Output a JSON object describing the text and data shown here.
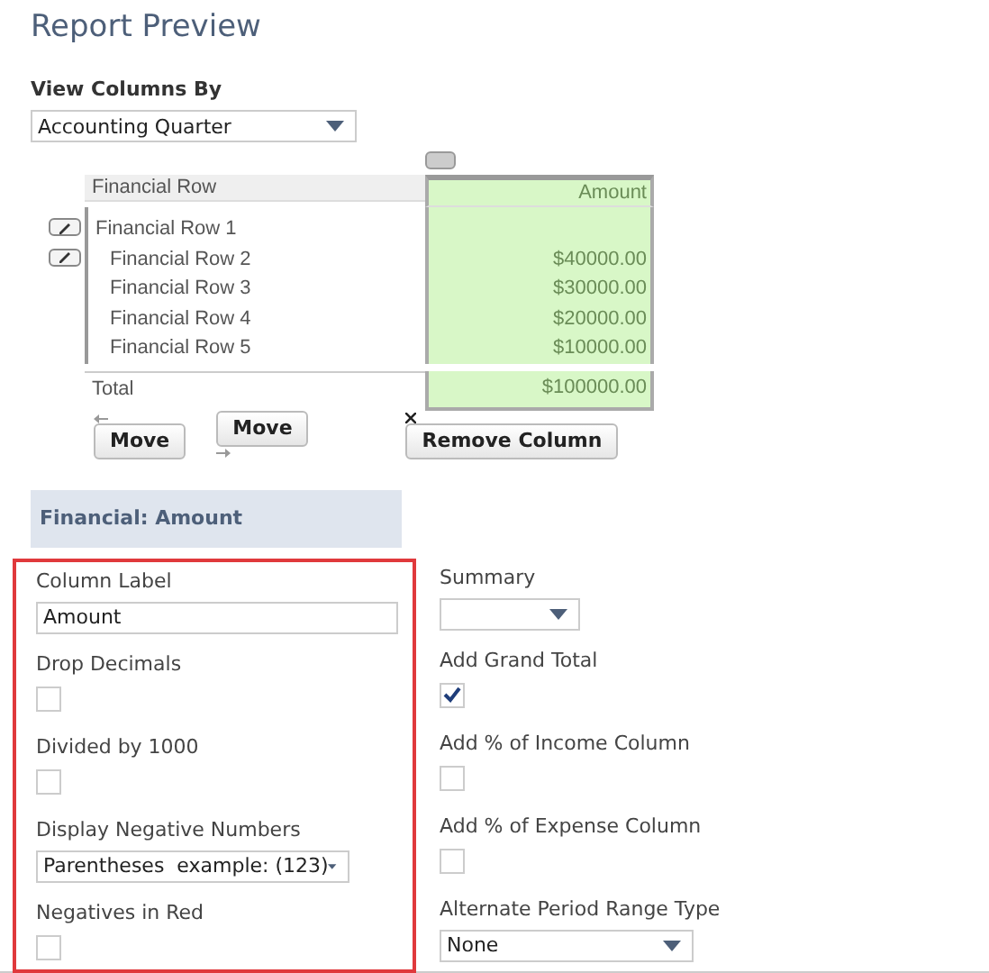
{
  "title": "Report Preview",
  "view_columns_by": {
    "label": "View Columns By",
    "value": "Accounting Quarter"
  },
  "table": {
    "columns": [
      "Financial Row",
      "Amount"
    ],
    "rows": [
      {
        "label": "Financial Row 1",
        "amount": "",
        "editable": true,
        "children": [
          {
            "label": "Financial Row 2",
            "amount": "$40000.00",
            "editable": true
          },
          {
            "label": "Financial Row 3",
            "amount": "$30000.00",
            "editable": false
          },
          {
            "label": "Financial Row 4",
            "amount": "$20000.00",
            "editable": false
          },
          {
            "label": "Financial Row 5",
            "amount": "$10000.00",
            "editable": false
          }
        ]
      }
    ],
    "total": {
      "label": "Total",
      "amount": "$100000.00"
    }
  },
  "buttons": [
    {
      "label": "Move",
      "kind": "move-left"
    },
    {
      "label": "Move",
      "kind": "move-right"
    },
    {
      "label": "Remove Column",
      "kind": "remove"
    }
  ],
  "section": {
    "title": "Financial: Amount"
  },
  "left_fields": [
    {
      "kind": "text",
      "label": "Column Label",
      "value": "Amount"
    },
    {
      "kind": "checkbox",
      "label": "Drop Decimals",
      "checked": false
    },
    {
      "kind": "checkbox",
      "label": "Divided by 1000",
      "checked": false
    },
    {
      "kind": "select",
      "label": "Display Negative Numbers",
      "value": "Parentheses  example: (123)"
    },
    {
      "kind": "checkbox",
      "label": "Negatives in Red",
      "checked": false
    }
  ],
  "right_fields": [
    {
      "kind": "select",
      "label": "Summary"
    },
    {
      "kind": "checkbox",
      "label": "Add Grand Total",
      "checked": true
    },
    {
      "kind": "checkbox",
      "label": "Add % of Income Column",
      "checked": false
    },
    {
      "kind": "checkbox",
      "label": "Add % of Expense Column",
      "checked": false
    },
    {
      "kind": "select",
      "label": "Alternate Period Range Type",
      "value": "None"
    }
  ]
}
